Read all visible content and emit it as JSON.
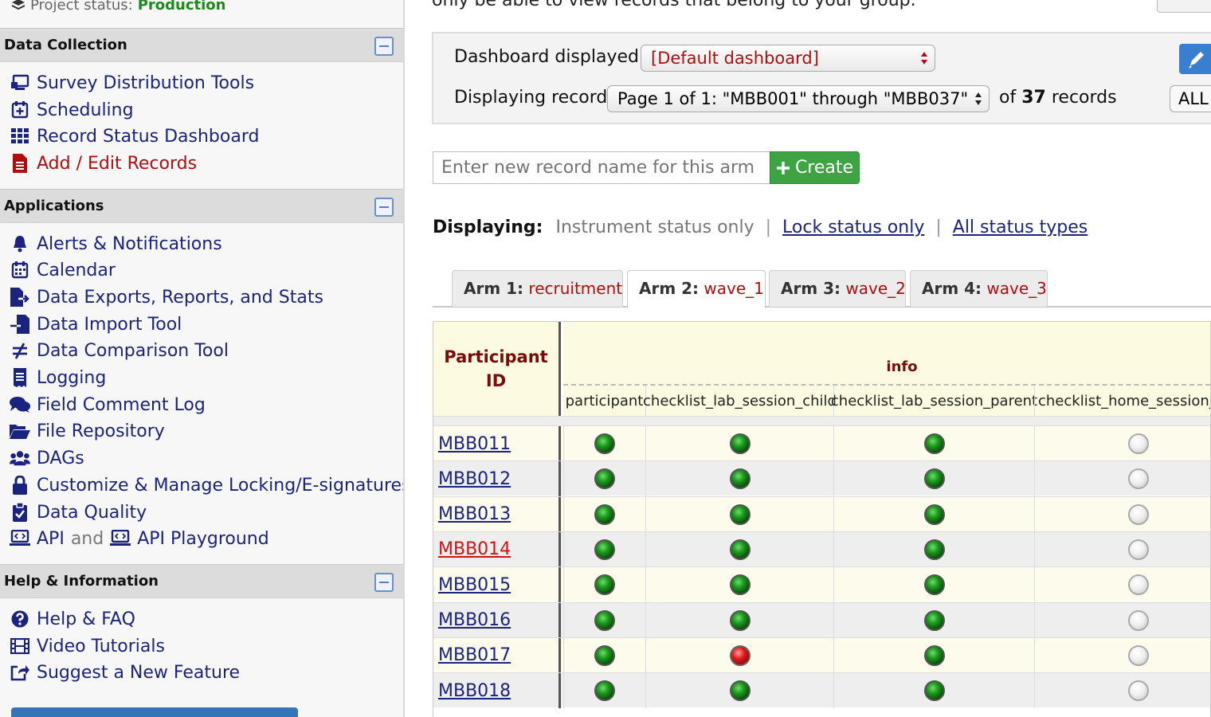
{
  "sidebar": {
    "project_status_label": "Project status:",
    "project_status_value": "Production",
    "sections": [
      {
        "title": "Data Collection",
        "items": [
          {
            "label": "Survey Distribution Tools",
            "icon": "survey-icon"
          },
          {
            "label": "Scheduling",
            "icon": "calendar-plus-icon"
          },
          {
            "label": "Record Status Dashboard",
            "icon": "grid-icon"
          },
          {
            "label": "Add / Edit Records",
            "icon": "file-icon",
            "active": true
          }
        ]
      },
      {
        "title": "Applications",
        "items": [
          {
            "label": "Alerts & Notifications",
            "icon": "bell-icon"
          },
          {
            "label": "Calendar",
            "icon": "calendar-icon"
          },
          {
            "label": "Data Exports, Reports, and Stats",
            "icon": "file-export-icon"
          },
          {
            "label": "Data Import Tool",
            "icon": "file-import-icon"
          },
          {
            "label": "Data Comparison Tool",
            "icon": "not-equal-icon"
          },
          {
            "label": "Logging",
            "icon": "receipt-icon"
          },
          {
            "label": "Field Comment Log",
            "icon": "comments-icon"
          },
          {
            "label": "File Repository",
            "icon": "folder-open-icon"
          },
          {
            "label": "DAGs",
            "icon": "users-icon"
          },
          {
            "label": "Customize & Manage Locking/E-signatures",
            "icon": "lock-icon"
          },
          {
            "label": "Data Quality",
            "icon": "clipboard-check-icon"
          }
        ],
        "api": {
          "label": "API",
          "and": "and",
          "playground_label": "API Playground",
          "icon": "laptop-code-icon"
        }
      },
      {
        "title": "Help & Information",
        "items": [
          {
            "label": "Help & FAQ",
            "icon": "question-circle-icon"
          },
          {
            "label": "Video Tutorials",
            "icon": "film-icon"
          },
          {
            "label": "Suggest a New Feature",
            "icon": "share-square-icon"
          }
        ]
      }
    ]
  },
  "main": {
    "top_text": "only be able to view records that belong to your group.",
    "dashboard_label": "Dashboard displayed:",
    "dashboard_value": "[Default dashboard]",
    "displaying_record_label": "Displaying record",
    "page_select_value": "Page 1 of 1: \"MBB001\" through \"MBB037\"",
    "of_label": "of",
    "records_count": "37",
    "records_label": "records",
    "all_label": "ALL",
    "new_record_placeholder": "Enter new record name for this arm",
    "create_label": "Create",
    "displaying_label": "Displaying:",
    "status_options": [
      "Instrument status only",
      "Lock status only",
      "All status types"
    ],
    "tabs": [
      {
        "arm": "Arm 1:",
        "name": "recruitment"
      },
      {
        "arm": "Arm 2:",
        "name": "wave_1",
        "active": true
      },
      {
        "arm": "Arm 3:",
        "name": "wave_2"
      },
      {
        "arm": "Arm 4:",
        "name": "wave_3"
      }
    ],
    "table": {
      "pid_header": "Participant ID",
      "group_header": "info",
      "columns": [
        "participant",
        "checklist_lab_session_child",
        "checklist_lab_session_parent",
        "checklist_home_session_cl"
      ],
      "rows": [
        {
          "id": "MBB011",
          "status": [
            "green",
            "green",
            "green",
            "gray"
          ]
        },
        {
          "id": "MBB012",
          "status": [
            "green",
            "green",
            "green",
            "gray"
          ]
        },
        {
          "id": "MBB013",
          "status": [
            "green",
            "green",
            "green",
            "gray"
          ]
        },
        {
          "id": "MBB014",
          "status": [
            "green",
            "green",
            "green",
            "gray"
          ],
          "highlight": true
        },
        {
          "id": "MBB015",
          "status": [
            "green",
            "green",
            "green",
            "gray"
          ]
        },
        {
          "id": "MBB016",
          "status": [
            "green",
            "green",
            "green",
            "gray"
          ]
        },
        {
          "id": "MBB017",
          "status": [
            "green",
            "red",
            "green",
            "gray"
          ]
        },
        {
          "id": "MBB018",
          "status": [
            "green",
            "green",
            "green",
            "gray"
          ]
        }
      ]
    }
  },
  "colors": {
    "link": "#1a237e",
    "accent_red": "#b10d0d",
    "create_green": "#3ea443",
    "production_green": "#1d8a1d"
  }
}
